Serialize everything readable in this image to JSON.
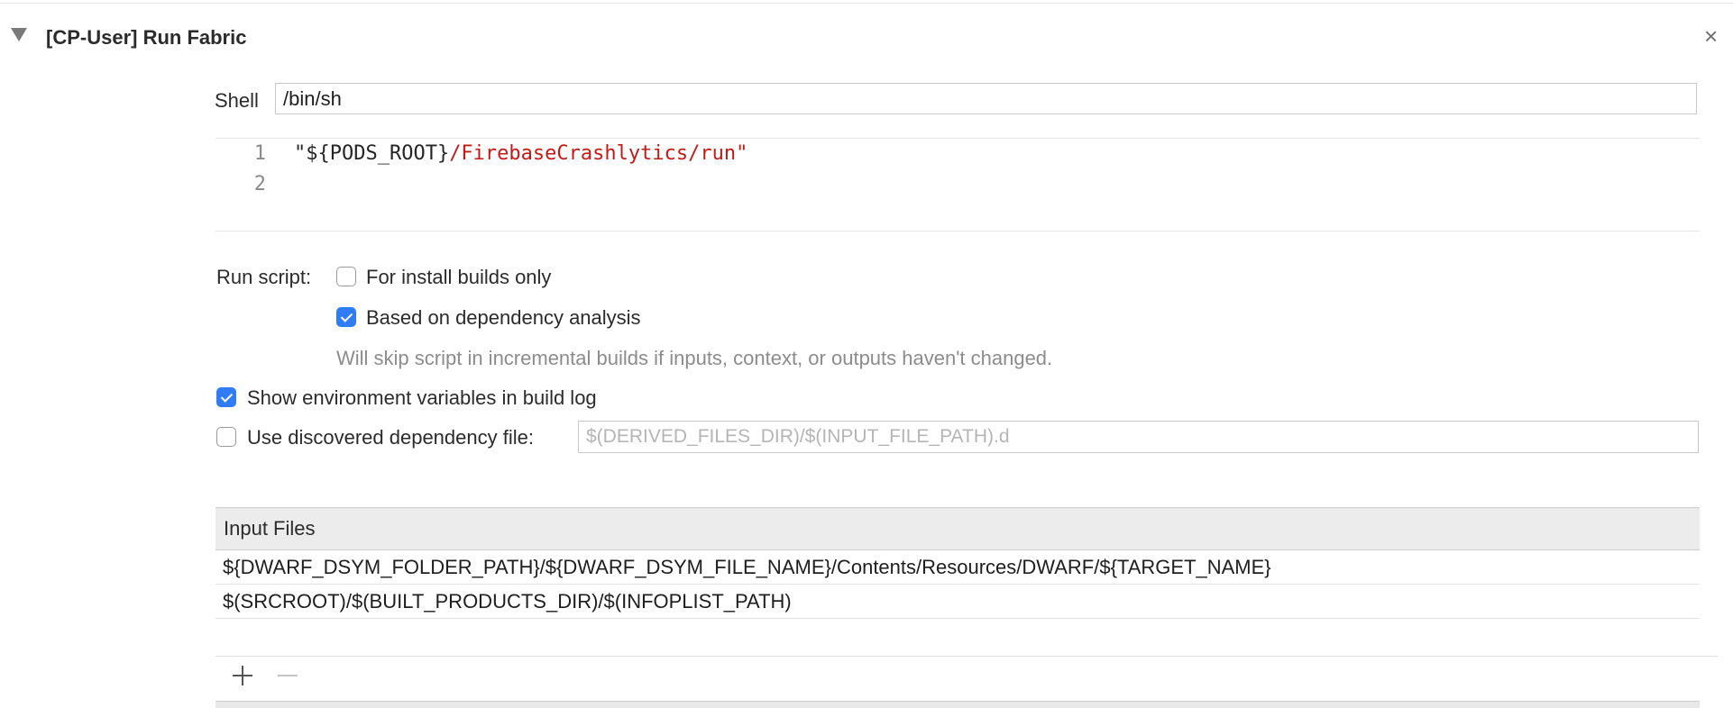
{
  "phase": {
    "title": "[CP-User] Run Fabric",
    "close_glyph": "×"
  },
  "shell": {
    "label": "Shell",
    "value": "/bin/sh"
  },
  "script_editor": {
    "lines": [
      {
        "number": "1",
        "var_part": "\"${PODS_ROOT}",
        "string_part": "/FirebaseCrashlytics/run\""
      },
      {
        "number": "2",
        "var_part": "",
        "string_part": ""
      }
    ]
  },
  "run_script": {
    "label": "Run script:",
    "install_builds_only": {
      "label": "For install builds only",
      "checked": false
    },
    "dependency_analysis": {
      "label": "Based on dependency analysis",
      "checked": true
    },
    "hint": "Will skip script in incremental builds if inputs, context, or outputs haven't changed."
  },
  "show_env_vars": {
    "label": "Show environment variables in build log",
    "checked": true
  },
  "discovered_dependency": {
    "label": "Use discovered dependency file:",
    "checked": false,
    "placeholder": "$(DERIVED_FILES_DIR)/$(INPUT_FILE_PATH).d",
    "value": ""
  },
  "input_files": {
    "header": "Input Files",
    "rows": [
      "${DWARF_DSYM_FOLDER_PATH}/${DWARF_DSYM_FILE_NAME}/Contents/Resources/DWARF/${TARGET_NAME}",
      "$(SRCROOT)/$(BUILT_PRODUCTS_DIR)/$(INFOPLIST_PATH)"
    ]
  },
  "icons": {
    "disclosure": "disclosure-triangle-icon",
    "close": "close-icon",
    "add": "plus-icon",
    "remove": "minus-icon"
  },
  "colors": {
    "accent": "#2f7cf6",
    "string_literal": "#c41a16",
    "hint_text": "#8c8c8c"
  }
}
